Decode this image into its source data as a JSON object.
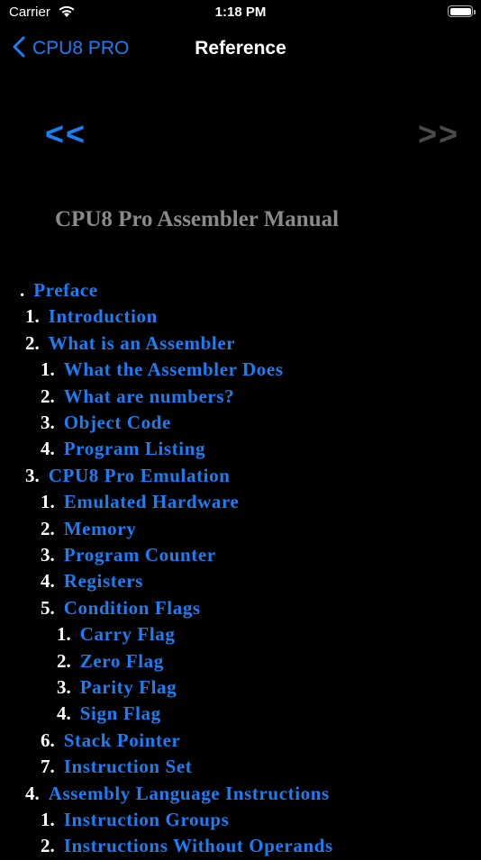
{
  "status_bar": {
    "carrier": "Carrier",
    "time": "1:18 PM"
  },
  "nav": {
    "back_label": "CPU8 PRO",
    "title": "Reference"
  },
  "pager": {
    "prev_label": "<<",
    "next_label": ">>"
  },
  "document": {
    "title": "CPU8 Pro Assembler Manual"
  },
  "toc": [
    {
      "num": ".",
      "label": "Preface",
      "level": 0
    },
    {
      "num": "1.",
      "label": "Introduction",
      "level": 1
    },
    {
      "num": "2.",
      "label": "What is an Assembler",
      "level": 1
    },
    {
      "num": "1.",
      "label": "What the Assembler Does",
      "level": 2
    },
    {
      "num": "2.",
      "label": "What are numbers?",
      "level": 2
    },
    {
      "num": "3.",
      "label": "Object Code",
      "level": 2
    },
    {
      "num": "4.",
      "label": "Program Listing",
      "level": 2
    },
    {
      "num": "3.",
      "label": "CPU8 Pro Emulation",
      "level": 1
    },
    {
      "num": "1.",
      "label": "Emulated Hardware",
      "level": 2
    },
    {
      "num": "2.",
      "label": "Memory",
      "level": 2
    },
    {
      "num": "3.",
      "label": "Program Counter",
      "level": 2
    },
    {
      "num": "4.",
      "label": "Registers",
      "level": 2
    },
    {
      "num": "5.",
      "label": "Condition Flags",
      "level": 2
    },
    {
      "num": "1.",
      "label": "Carry Flag",
      "level": 3
    },
    {
      "num": "2.",
      "label": "Zero Flag",
      "level": 3
    },
    {
      "num": "3.",
      "label": "Parity Flag",
      "level": 3
    },
    {
      "num": "4.",
      "label": "Sign Flag",
      "level": 3
    },
    {
      "num": "6.",
      "label": "Stack Pointer",
      "level": 2
    },
    {
      "num": "7.",
      "label": "Instruction Set",
      "level": 2
    },
    {
      "num": "4.",
      "label": "Assembly Language Instructions",
      "level": 1
    },
    {
      "num": "1.",
      "label": "Instruction Groups",
      "level": 2
    },
    {
      "num": "2.",
      "label": "Instructions Without Operands",
      "level": 2
    }
  ],
  "colors": {
    "link": "#1a7ef5",
    "disabled": "#4a4a4a",
    "title": "#8a8a8a",
    "background": "#000000"
  }
}
